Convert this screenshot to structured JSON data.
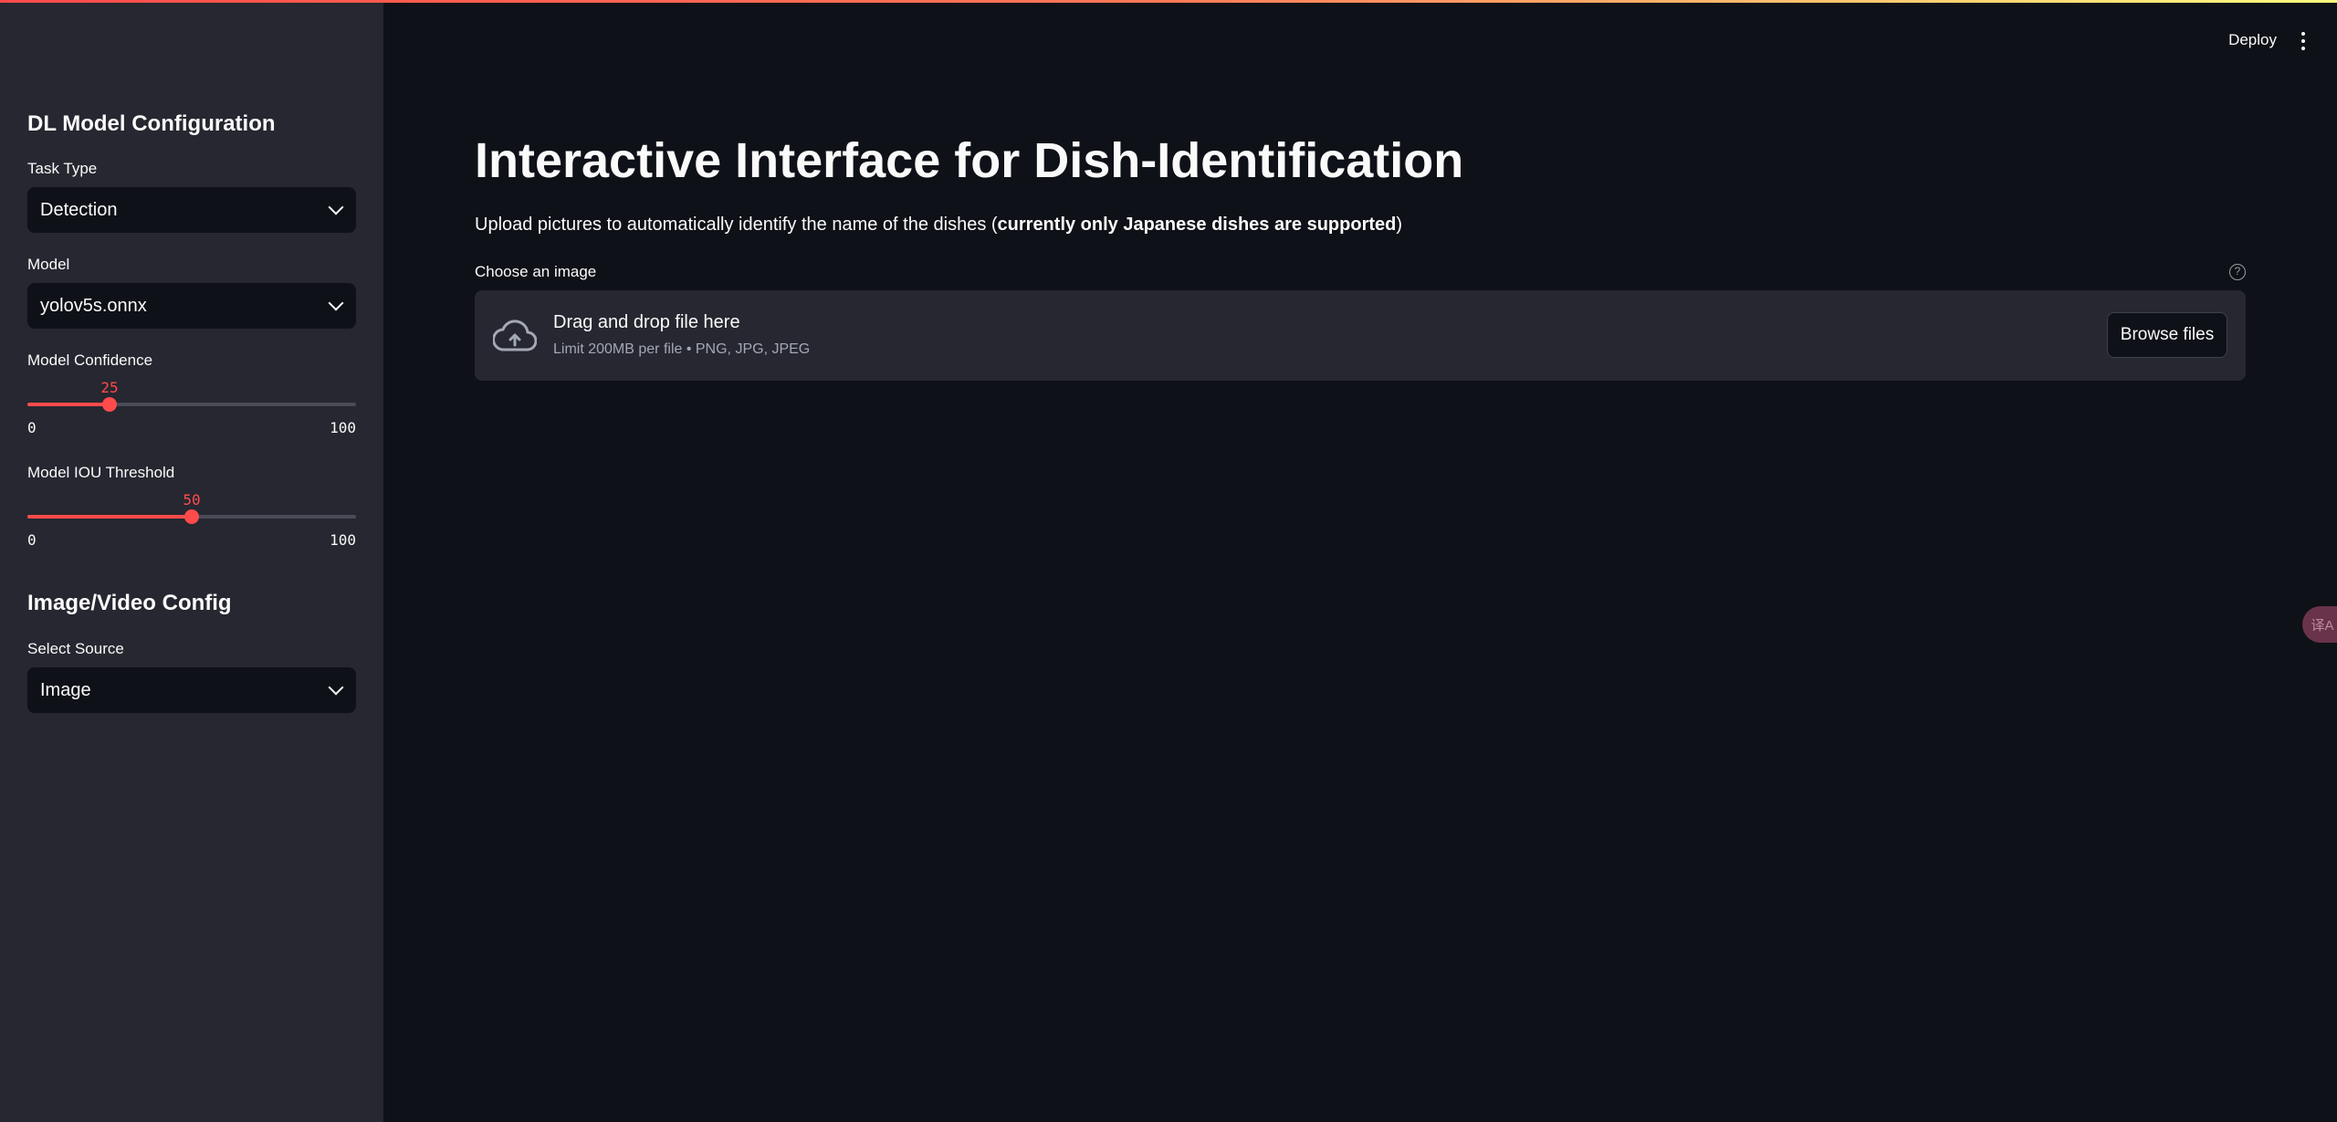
{
  "sidebar": {
    "model_config_heading": "DL Model Configuration",
    "task_type": {
      "label": "Task Type",
      "value": "Detection"
    },
    "model": {
      "label": "Model",
      "value": "yolov5s.onnx"
    },
    "confidence": {
      "label": "Model Confidence",
      "value": "25",
      "min": "0",
      "max": "100",
      "fraction": 0.25
    },
    "iou": {
      "label": "Model IOU Threshold",
      "value": "50",
      "min": "0",
      "max": "100",
      "fraction": 0.5
    },
    "source_heading": "Image/Video Config",
    "source": {
      "label": "Select Source",
      "value": "Image"
    }
  },
  "header": {
    "deploy_label": "Deploy"
  },
  "main": {
    "title": "Interactive Interface for Dish-Identification",
    "subtitle_prefix": "Upload pictures to automatically identify the name of the dishes (",
    "subtitle_bold": "currently only Japanese dishes are supported",
    "subtitle_suffix": ")",
    "uploader": {
      "label": "Choose an image",
      "help_icon": "?",
      "drop_text": "Drag and drop file here",
      "limit_text": "Limit 200MB per file • PNG, JPG, JPEG",
      "browse_label": "Browse files"
    }
  },
  "floating": {
    "translate_icon": "译A"
  },
  "colors": {
    "accent": "#ff4b4b",
    "background": "#0e1117",
    "sidebar": "#262730"
  }
}
